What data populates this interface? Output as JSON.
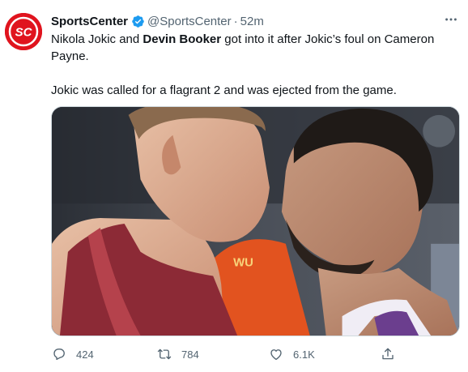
{
  "account": {
    "name": "SportsCenter",
    "handle": "@SportsCenter",
    "separator": "·",
    "time": "52m",
    "avatar_text": "SC"
  },
  "tweet": {
    "line1_pre": "Nikola Jokic and ",
    "line1_bold": "Devin Booker",
    "line1_post": " got into it after Jokic’s foul on Cameron Payne.",
    "line2": "Jokic was called for a flagrant 2 and was ejected from the game."
  },
  "media": {
    "jersey_text": "WU"
  },
  "actions": {
    "replies": "424",
    "retweets": "784",
    "likes": "6.1K"
  },
  "colors": {
    "brand_red": "#e0141e",
    "verified_blue": "#1d9bf0",
    "muted": "#536471"
  }
}
